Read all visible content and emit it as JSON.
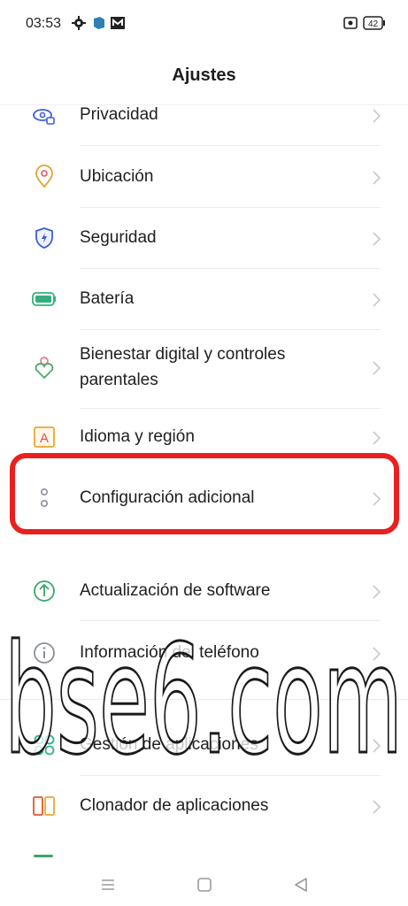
{
  "status_bar": {
    "time": "03:53",
    "battery": "42"
  },
  "header": {
    "title": "Ajustes"
  },
  "settings": [
    {
      "label": "Privacidad",
      "icon": "privacy-icon"
    },
    {
      "label": "Ubicación",
      "icon": "location-pin-icon"
    },
    {
      "label": "Seguridad",
      "icon": "shield-icon"
    },
    {
      "label": "Batería",
      "icon": "battery-icon"
    },
    {
      "label_line1": "Bienestar digital y controles",
      "label_line2": "parentales",
      "icon": "digital-wellbeing-icon"
    },
    {
      "label": "Idioma y región",
      "icon": "language-icon"
    },
    {
      "label": "Configuración adicional",
      "icon": "additional-settings-icon"
    },
    {
      "label": "Actualización de software",
      "icon": "update-arrow-icon"
    },
    {
      "label": "Información del teléfono",
      "icon": "info-icon"
    },
    {
      "label": "Gestión de aplicaciones",
      "icon": "apps-grid-icon"
    },
    {
      "label": "Clonador de aplicaciones",
      "icon": "app-cloner-icon"
    }
  ],
  "watermark": {
    "text": "bse6.com"
  },
  "colors": {
    "highlight": "#ea1f1f",
    "update": "#3aa66a",
    "security": "#3d5fd6",
    "location": "#e2a436"
  }
}
